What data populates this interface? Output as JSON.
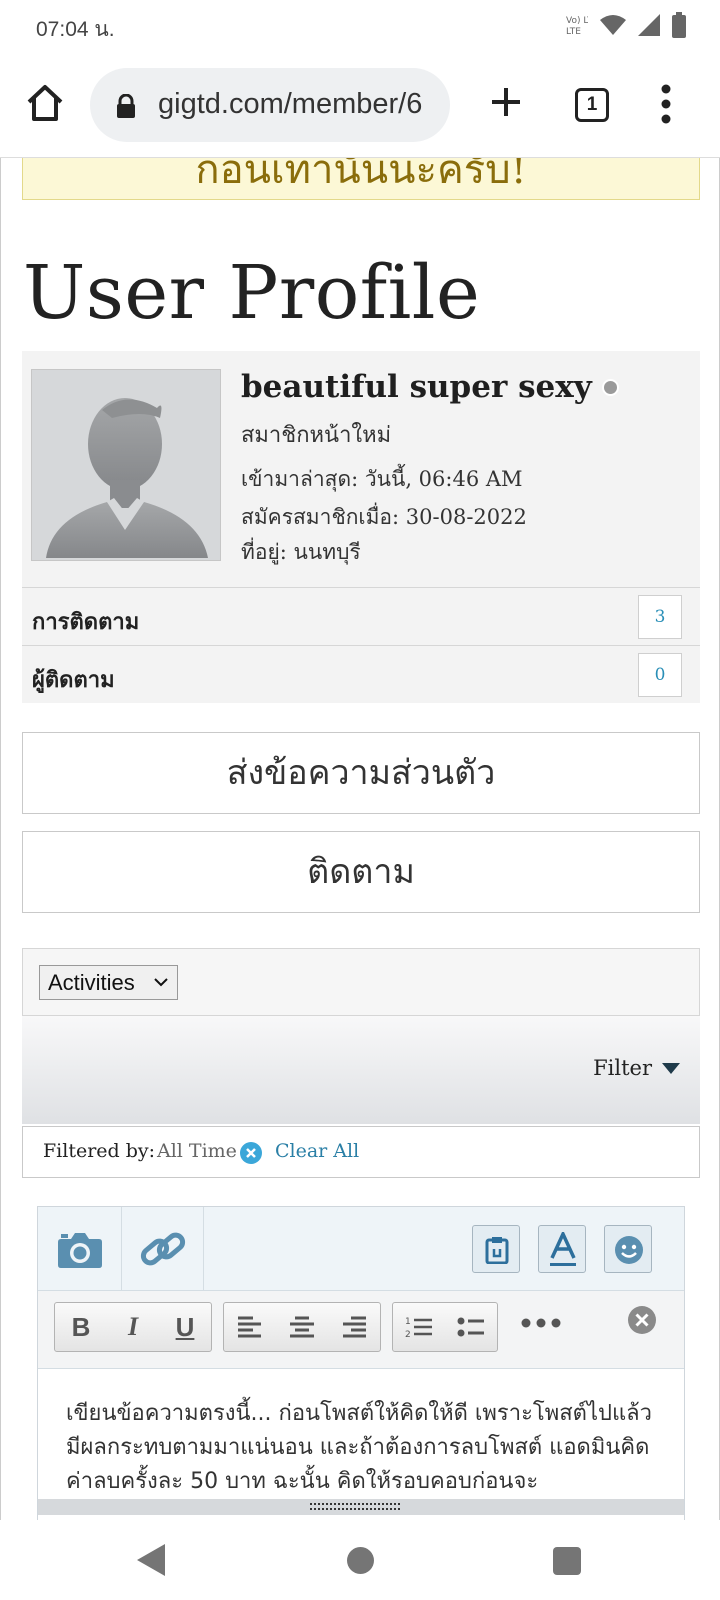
{
  "status_bar": {
    "time": "07:04 น.",
    "icons": [
      "volte-icon",
      "wifi-icon",
      "signal-icon",
      "battery-icon"
    ],
    "volte_label": "Vo) LTE"
  },
  "browser": {
    "url": "gigtd.com/member/6",
    "tab_count": "1"
  },
  "notice": {
    "text": "ก่อนเท่านั้นนะครับ!"
  },
  "page": {
    "title": "User Profile"
  },
  "profile": {
    "username": "beautiful super sexy",
    "rank": "สมาชิกหน้าใหม่",
    "last_seen": "เข้ามาล่าสุด: วันนี้, 06:46 AM",
    "joined": "สมัครสมาชิกเมื่อ: 30-08-2022",
    "location": "ที่อยู่: นนทบุรี",
    "following_label": "การติดตาม",
    "following_count": "3",
    "followers_label": "ผู้ติดตาม",
    "followers_count": "0"
  },
  "actions": {
    "private_message": "ส่งข้อความส่วนตัว",
    "follow": "ติดตาม"
  },
  "activities": {
    "selected": "Activities"
  },
  "filter": {
    "label": "Filter",
    "filtered_by": "Filtered by:",
    "value": "All Time",
    "clear_all": "Clear All"
  },
  "editor": {
    "placeholder_text": "เขียนข้อความตรงนี้... ก่อนโพสต์ให้คิดให้ดี เพราะโพสต์ไปแล้วมีผลกระทบตามมาแน่นอน และถ้าต้องการลบโพสต์ แอดมินคิดค่าลบครั้งละ 50 บาท ฉะนั้น คิดให้รอบคอบก่อนจะ",
    "bold": "B",
    "italic": "I",
    "underline": "U",
    "accent_color": "#5a8fb0"
  }
}
